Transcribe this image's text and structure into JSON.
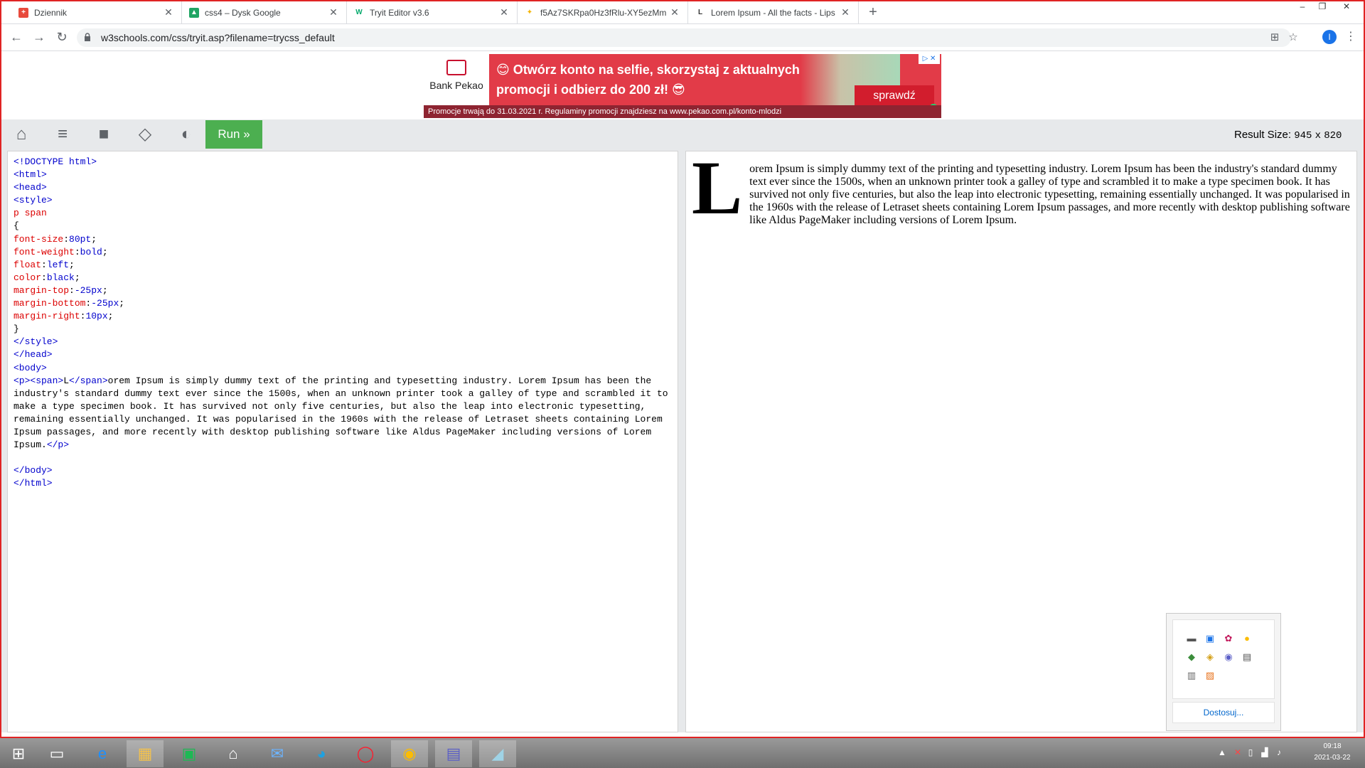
{
  "browser": {
    "tabs": [
      {
        "title": "Dziennik",
        "favicon_color": "#e84a3c",
        "favicon_glyph": "+"
      },
      {
        "title": "css4 – Dysk Google",
        "favicon_color": "#1fa463",
        "favicon_glyph": "▲"
      },
      {
        "title": "Tryit Editor v3.6",
        "favicon_color": "#04aa6d",
        "favicon_glyph": "W"
      },
      {
        "title": "f5Az7SKRpa0Hz3fRlu-XY5ezMm",
        "favicon_color": "#f4b400",
        "favicon_glyph": "✦"
      },
      {
        "title": "Lorem Ipsum - All the facts - Lips",
        "favicon_color": "#333333",
        "favicon_glyph": "L"
      }
    ],
    "url": "w3schools.com/css/tryit.asp?filename=trycss_default",
    "profile_initial": "I"
  },
  "ad": {
    "brand": "Bank Pekao",
    "headline_line1": "😊 Otwórz konto na selfie, skorzystaj z aktualnych",
    "headline_line2": "promocji i odbierz do 200 zł! 😎",
    "cta": "sprawdź",
    "footer": "Promocje trwają do 31.03.2021 r. Regulaminy promocji znajdziesz na www.pekao.com.pl/konto-mlodzi"
  },
  "toolbar": {
    "run_label": "Run »",
    "result_size_label": "Result Size:",
    "result_width": "945",
    "result_x": "x",
    "result_height": "820"
  },
  "code_lines": [
    "<!DOCTYPE html>",
    "<html>",
    "<head>",
    "<style>",
    "p span",
    "{",
    "font-size:80pt;",
    "font-weight:bold;",
    "float:left;",
    "color:black;",
    "margin-top:-25px;",
    "margin-bottom:-25px;",
    "margin-right:10px;",
    "}",
    "</style>",
    "</head>",
    "<body>",
    "<p><span>L</span>orem Ipsum is simply dummy text of the printing and typesetting industry. Lorem Ipsum has been the industry's standard dummy text ever since the 1500s, when an unknown printer took a galley of type and scrambled it to make a type specimen book. It has survived not only five centuries, but also the leap into electronic typesetting, remaining essentially unchanged. It was popularised in the 1960s with the release of Letraset sheets containing Lorem Ipsum passages, and more recently with desktop publishing software like Aldus PageMaker including versions of Lorem Ipsum.</p>",
    "",
    "</body>",
    "</html>"
  ],
  "result": {
    "drop_letter": "L",
    "paragraph_rest": "orem Ipsum is simply dummy text of the printing and typesetting industry. Lorem Ipsum has been the industry's standard dummy text ever since the 1500s, when an unknown printer took a galley of type and scrambled it to make a type specimen book. It has survived not only five centuries, but also the leap into electronic typesetting, remaining essentially unchanged. It was popularised in the 1960s with the release of Letraset sheets containing Lorem Ipsum passages, and more recently with desktop publishing software like Aldus PageMaker including versions of Lorem Ipsum."
  },
  "tray_popup": {
    "icons": [
      "monitor-icon",
      "network-app-icon",
      "paint-icon",
      "update-icon",
      "shield-icon",
      "box-icon",
      "teams-icon",
      "device-icon",
      "printer-icon",
      "flame-icon"
    ],
    "customize_label": "Dostosuj..."
  },
  "taskbar": {
    "apps": [
      "start-icon",
      "lenovo-icon",
      "ie-icon",
      "file-explorer-icon",
      "store-icon",
      "home-icon",
      "mail-icon",
      "edge-icon",
      "opera-icon",
      "chrome-icon",
      "teams-icon",
      "app-icon"
    ],
    "time": "09:18",
    "date": "2021-03-22"
  }
}
